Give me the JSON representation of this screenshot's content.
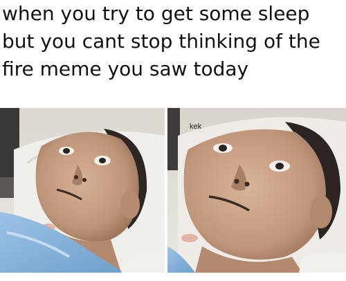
{
  "caption": {
    "lines": [
      "when you try to get some sleep",
      "but you cant stop thinking of the",
      "fire meme you saw today"
    ]
  },
  "panels": {
    "left": {
      "image": "cpr-training-mannequin-in-bed"
    },
    "right": {
      "image": "cpr-training-mannequin-in-bed-closeup",
      "label": "kek"
    }
  },
  "colors": {
    "background": "#ffffff",
    "text": "#111111",
    "skin": "#c89f83",
    "pillow": "#ece9e4",
    "blanket": "#8db6da"
  }
}
